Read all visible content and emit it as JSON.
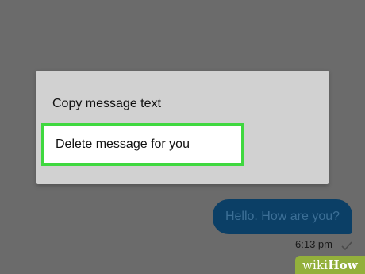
{
  "context_menu": {
    "items": [
      {
        "label": "Copy message text"
      },
      {
        "label": "Delete message for you"
      }
    ],
    "highlight_color": "#3fd83f"
  },
  "chat": {
    "message_text": "Hello. How are you?",
    "timestamp": "6:13 pm",
    "status_icon": "check-icon",
    "bubble_color": "#0b3f66"
  },
  "watermark": {
    "part1": "wiki",
    "part2": "How"
  }
}
